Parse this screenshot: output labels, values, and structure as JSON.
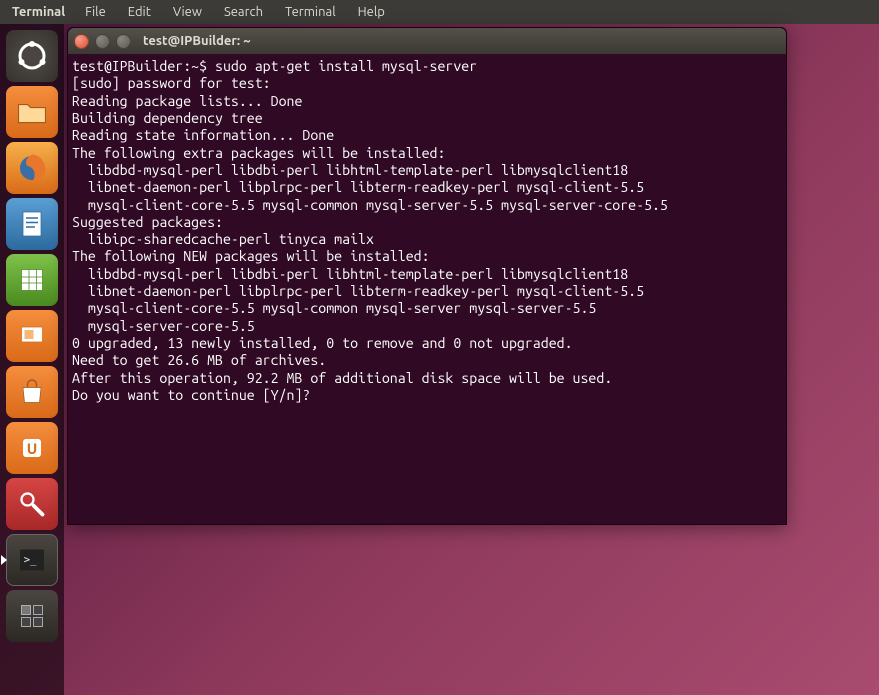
{
  "menubar": {
    "app": "Terminal",
    "items": [
      "File",
      "Edit",
      "View",
      "Search",
      "Terminal",
      "Help"
    ]
  },
  "launcher": {
    "items": [
      {
        "name": "dash",
        "label": "Dash Home"
      },
      {
        "name": "files",
        "label": "Files"
      },
      {
        "name": "firefox",
        "label": "Firefox"
      },
      {
        "name": "writer",
        "label": "LibreOffice Writer"
      },
      {
        "name": "calc",
        "label": "LibreOffice Calc"
      },
      {
        "name": "impress",
        "label": "LibreOffice Impress"
      },
      {
        "name": "software",
        "label": "Ubuntu Software Center"
      },
      {
        "name": "ubuntuone",
        "label": "Ubuntu One"
      },
      {
        "name": "settings",
        "label": "System Settings"
      },
      {
        "name": "terminal",
        "label": "Terminal",
        "active": true
      },
      {
        "name": "workspace",
        "label": "Workspace Switcher"
      }
    ]
  },
  "window": {
    "title": "test@IPBuilder: ~"
  },
  "terminal": {
    "lines": [
      "test@IPBuilder:~$ sudo apt-get install mysql-server",
      "[sudo] password for test:",
      "Reading package lists... Done",
      "Building dependency tree",
      "Reading state information... Done",
      "The following extra packages will be installed:",
      "  libdbd-mysql-perl libdbi-perl libhtml-template-perl libmysqlclient18",
      "  libnet-daemon-perl libplrpc-perl libterm-readkey-perl mysql-client-5.5",
      "  mysql-client-core-5.5 mysql-common mysql-server-5.5 mysql-server-core-5.5",
      "Suggested packages:",
      "  libipc-sharedcache-perl tinyca mailx",
      "The following NEW packages will be installed:",
      "  libdbd-mysql-perl libdbi-perl libhtml-template-perl libmysqlclient18",
      "  libnet-daemon-perl libplrpc-perl libterm-readkey-perl mysql-client-5.5",
      "  mysql-client-core-5.5 mysql-common mysql-server mysql-server-5.5",
      "  mysql-server-core-5.5",
      "0 upgraded, 13 newly installed, 0 to remove and 0 not upgraded.",
      "Need to get 26.6 MB of archives.",
      "After this operation, 92.2 MB of additional disk space will be used.",
      "Do you want to continue [Y/n]?"
    ]
  }
}
